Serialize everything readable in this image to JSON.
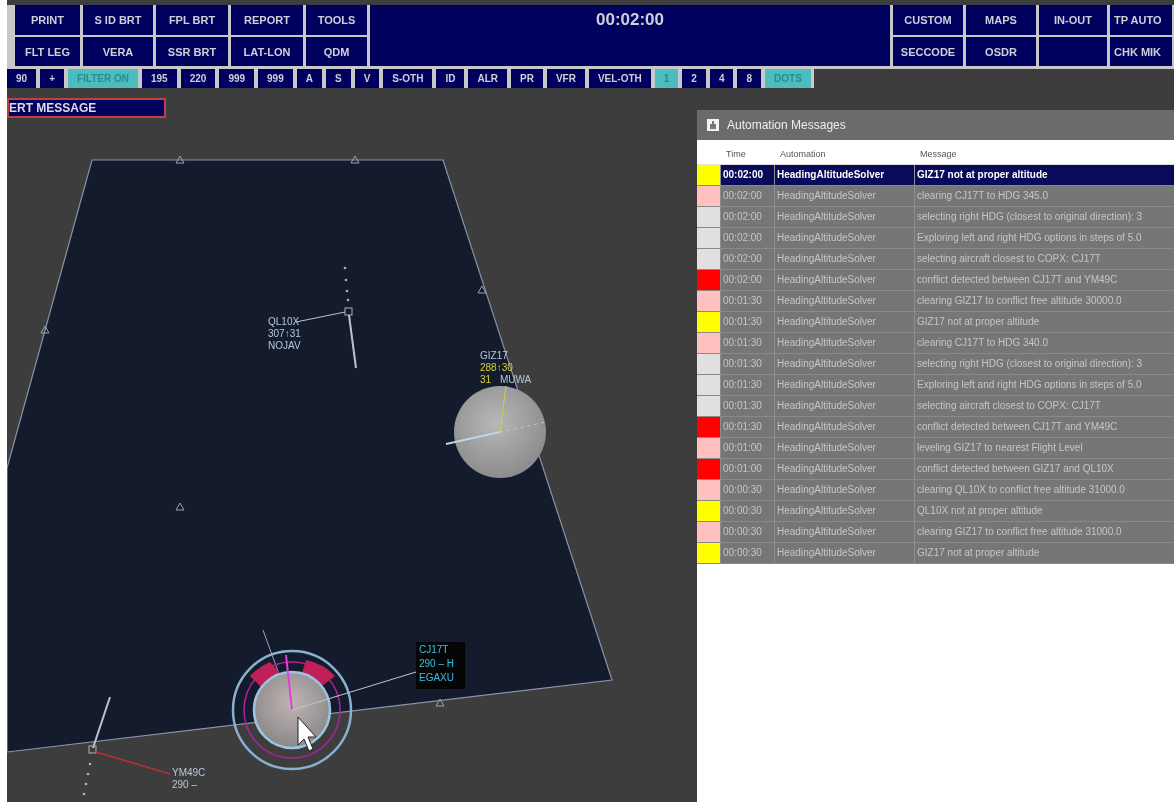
{
  "toolbar": {
    "row1_left": [
      "PRINT",
      "S ID BRT",
      "FPL BRT",
      "REPORT",
      "TOOLS"
    ],
    "clock": "00:02:00",
    "row1_right": [
      {
        "kind": "button",
        "label": "CUSTOM"
      },
      {
        "kind": "button",
        "label": "MAPS"
      },
      {
        "kind": "button",
        "label": "IN-OUT"
      },
      {
        "kind": "button",
        "label": "TP AUTO"
      }
    ],
    "row2_left": [
      "FLT LEG",
      "VERA",
      "SSR BRT",
      "LAT-LON",
      "QDM"
    ],
    "row2_right": [
      {
        "kind": "button",
        "label": "SECCODE"
      },
      {
        "kind": "button",
        "label": "OSDR"
      },
      {
        "kind": "blank"
      },
      {
        "kind": "button",
        "label": "CHK MIK"
      }
    ]
  },
  "filter_bar": [
    {
      "label": "90",
      "selected": false
    },
    {
      "label": "+",
      "selected": false
    },
    {
      "label": "FILTER ON",
      "selected": true
    },
    {
      "label": "195",
      "selected": false
    },
    {
      "label": "220",
      "selected": false
    },
    {
      "label": "999",
      "selected": false
    },
    {
      "label": "999",
      "selected": false
    },
    {
      "label": "A",
      "selected": false
    },
    {
      "label": "S",
      "selected": false
    },
    {
      "label": "V",
      "selected": false
    },
    {
      "label": "S-OTH",
      "selected": false
    },
    {
      "label": "ID",
      "selected": false
    },
    {
      "label": "ALR",
      "selected": false
    },
    {
      "label": "PR",
      "selected": false
    },
    {
      "label": "VFR",
      "selected": false
    },
    {
      "label": "VEL-OTH",
      "selected": false
    },
    {
      "label": "1",
      "selected": true
    },
    {
      "label": "2",
      "selected": false
    },
    {
      "label": "4",
      "selected": false
    },
    {
      "label": "8",
      "selected": false
    },
    {
      "label": "DOTS",
      "selected": true
    }
  ],
  "alert_box": "ERT MESSAGE",
  "tracks": [
    {
      "boxed": false,
      "lines": [
        [
          {
            "text": "QL10X",
            "kind": "normal"
          }
        ],
        [
          {
            "text": "307↑31",
            "kind": "normal"
          }
        ],
        [
          {
            "text": "NOJAV",
            "kind": "normal"
          }
        ]
      ]
    },
    {
      "boxed": false,
      "lines": [
        [
          {
            "text": "GIZ17",
            "kind": "normal"
          }
        ],
        [
          {
            "text": "288↑30",
            "kind": "alert"
          }
        ],
        [
          {
            "text": "31",
            "kind": "alert"
          },
          {
            "text": "MUWA",
            "kind": "normal"
          }
        ]
      ]
    },
    {
      "boxed": true,
      "lines": [
        [
          {
            "text": "CJ17T",
            "kind": "selected"
          }
        ],
        [
          {
            "text": "290 – H",
            "kind": "selected"
          }
        ],
        [
          {
            "text": "EGAXU",
            "kind": "selected"
          }
        ]
      ]
    },
    {
      "boxed": false,
      "lines": [
        [
          {
            "text": "YM49C",
            "kind": "normal"
          }
        ],
        [
          {
            "text": "290 –",
            "kind": "normal"
          }
        ]
      ]
    }
  ],
  "messages": {
    "title": "Automation Messages",
    "columns": [
      "Time",
      "Automation",
      "Message"
    ],
    "rows": [
      {
        "color": "#ffff00",
        "time": "00:02:00",
        "automation": "HeadingAltitudeSolver",
        "message": "GIZ17 not at proper altitude",
        "selected": true
      },
      {
        "color": "#ffc0c0",
        "time": "00:02:00",
        "automation": "HeadingAltitudeSolver",
        "message": "clearing CJ17T to HDG 345.0",
        "selected": false
      },
      {
        "color": "#e0e0e0",
        "time": "00:02:00",
        "automation": "HeadingAltitudeSolver",
        "message": "selecting right HDG (closest to original direction): 3",
        "selected": false
      },
      {
        "color": "#e0e0e0",
        "time": "00:02:00",
        "automation": "HeadingAltitudeSolver",
        "message": "Exploring left and right HDG options in steps of 5.0",
        "selected": false
      },
      {
        "color": "#e0e0e0",
        "time": "00:02:00",
        "automation": "HeadingAltitudeSolver",
        "message": "selecting aircraft closest to COPX: CJ17T",
        "selected": false
      },
      {
        "color": "#ff0000",
        "time": "00:02:00",
        "automation": "HeadingAltitudeSolver",
        "message": "conflict detected between CJ17T and YM49C",
        "selected": false
      },
      {
        "color": "#ffc0c0",
        "time": "00:01:30",
        "automation": "HeadingAltitudeSolver",
        "message": "clearing GIZ17 to conflict free altitude 30000.0",
        "selected": false
      },
      {
        "color": "#ffff00",
        "time": "00:01:30",
        "automation": "HeadingAltitudeSolver",
        "message": "GIZ17 not at proper altitude",
        "selected": false
      },
      {
        "color": "#ffc0c0",
        "time": "00:01:30",
        "automation": "HeadingAltitudeSolver",
        "message": "clearing CJ17T to HDG 340.0",
        "selected": false
      },
      {
        "color": "#e0e0e0",
        "time": "00:01:30",
        "automation": "HeadingAltitudeSolver",
        "message": "selecting right HDG (closest to original direction): 3",
        "selected": false
      },
      {
        "color": "#e0e0e0",
        "time": "00:01:30",
        "automation": "HeadingAltitudeSolver",
        "message": "Exploring left and right HDG options in steps of 5.0",
        "selected": false
      },
      {
        "color": "#e0e0e0",
        "time": "00:01:30",
        "automation": "HeadingAltitudeSolver",
        "message": "selecting aircraft closest to COPX: CJ17T",
        "selected": false
      },
      {
        "color": "#ff0000",
        "time": "00:01:30",
        "automation": "HeadingAltitudeSolver",
        "message": "conflict detected between CJ17T and YM49C",
        "selected": false
      },
      {
        "color": "#ffc0c0",
        "time": "00:01:00",
        "automation": "HeadingAltitudeSolver",
        "message": "leveling GIZ17 to nearest Flight Level",
        "selected": false
      },
      {
        "color": "#ff0000",
        "time": "00:01:00",
        "automation": "HeadingAltitudeSolver",
        "message": "conflict detected between GIZ17 and QL10X",
        "selected": false
      },
      {
        "color": "#ffc0c0",
        "time": "00:00:30",
        "automation": "HeadingAltitudeSolver",
        "message": "clearing QL10X to conflict free altitude 31000.0",
        "selected": false
      },
      {
        "color": "#ffff00",
        "time": "00:00:30",
        "automation": "HeadingAltitudeSolver",
        "message": "QL10X not at proper altitude",
        "selected": false
      },
      {
        "color": "#ffc0c0",
        "time": "00:00:30",
        "automation": "HeadingAltitudeSolver",
        "message": "clearing GIZ17 to conflict free altitude 31000.0",
        "selected": false
      },
      {
        "color": "#ffff00",
        "time": "00:00:30",
        "automation": "HeadingAltitudeSolver",
        "message": "GIZ17 not at proper altitude",
        "selected": false
      }
    ]
  }
}
